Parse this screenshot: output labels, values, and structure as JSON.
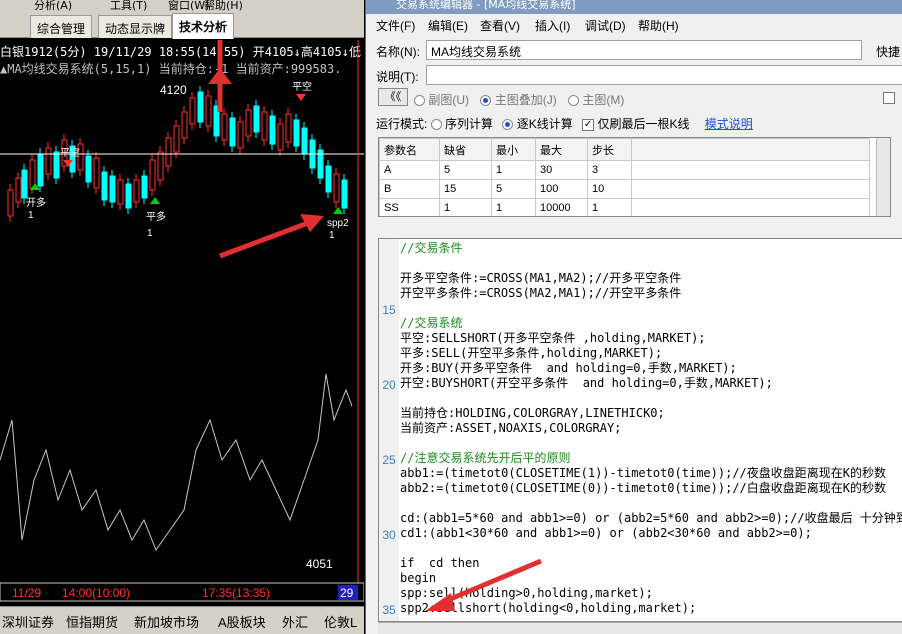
{
  "chart_window": {
    "top_menu": [
      "分析(A)",
      "工具(T)",
      "窗口(W)",
      "帮助(H)"
    ],
    "tabs": [
      "综合管理",
      "动态显示牌",
      "技术分析"
    ],
    "header_line": "白银1912(5分) 19/11/29 18:55(14:55) 开4105↓高4105↓低",
    "indicator_line": "▲MA均线交易系统(5,15,1) 当前持仓:-1 当前资产:999583.",
    "price_high_label": "4120",
    "price_low_label": "4051",
    "signals": [
      "平空",
      "开多",
      "平多",
      "开空",
      "spp2"
    ],
    "signal_numbers": [
      "1",
      "1",
      "1"
    ],
    "time_axis": [
      "11/29",
      "14:00(10:00)",
      "17:35(13:35)",
      "29"
    ],
    "bottom_tabs": [
      "深圳证券",
      "恒指期货",
      "新加坡市场",
      "A股板块",
      "外汇",
      "伦敦L"
    ],
    "colors": {
      "up": "#ff3030",
      "down": "#00ffff",
      "signal_up": "#00d000",
      "signal_down": "#ff3030"
    }
  },
  "editor": {
    "title": "交易系统编辑器 - [MA均线交易系统]",
    "menu": [
      "文件(F)",
      "编辑(E)",
      "查看(V)",
      "插入(I)",
      "调试(D)",
      "帮助(H)"
    ],
    "name_label": "名称(N):",
    "name_value": "MA均线交易系统",
    "hotkey_label": "快捷",
    "desc_label": "说明(T):",
    "back_button": "《《",
    "placement_options": [
      {
        "label": "副图(U)",
        "selected": false
      },
      {
        "label": "主图叠加(J)",
        "selected": true
      },
      {
        "label": "主图(M)",
        "selected": false
      }
    ],
    "run_mode_label": "运行模式:",
    "run_options": [
      {
        "label": "序列计算",
        "selected": false
      },
      {
        "label": "逐K线计算",
        "selected": true
      }
    ],
    "only_last_bar_label": "仅刷最后一根K线",
    "only_last_bar_checked": true,
    "mode_help_link": "模式说明",
    "param_headers": [
      "参数名",
      "缺省",
      "最小",
      "最大",
      "步长"
    ],
    "params": [
      [
        "A",
        "5",
        "1",
        "30",
        "3"
      ],
      [
        "B",
        "15",
        "5",
        "100",
        "10"
      ],
      [
        "SS",
        "1",
        "1",
        "10000",
        "1"
      ]
    ],
    "line_numbers": [
      "15",
      "20",
      "25",
      "30",
      "35"
    ],
    "code_lines": [
      "//交易条件",
      "",
      "开多平空条件:=CROSS(MA1,MA2);//开多平空条件",
      "开空平多条件:=CROSS(MA2,MA1);//开空平多条件",
      "",
      "//交易系统",
      "平空:SELLSHORT(开多平空条件 ,holding,MARKET);",
      "平多:SELL(开空平多条件,holding,MARKET);",
      "开多:BUY(开多平空条件  and holding=0,手数,MARKET);",
      "开空:BUYSHORT(开空平多条件  and holding=0,手数,MARKET);",
      "",
      "当前持仓:HOLDING,COLORGRAY,LINETHICK0;",
      "当前资产:ASSET,NOAXIS,COLORGRAY;",
      "",
      "//注意交易系统先开后平的原则",
      "abb1:=(timetot0(CLOSETIME(1))-timetot0(time));//夜盘收盘距离现在K的秒数",
      "abb2:=(timetot0(CLOSETIME(0))-timetot0(time));//白盘收盘距离现在K的秒数",
      "",
      "cd:(abb1=5*60 and abb1>=0) or (abb2=5*60 and abb2>=0);//收盘最后 十分钟到",
      "cd1:(abb1<30*60 and abb1>=0) or (abb2<30*60 and abb2>=0);",
      "",
      "if  cd then",
      "begin",
      "spp:sell(holding>0,holding,market);",
      "spp2:sellshort(holding<0,holding,market);"
    ]
  }
}
